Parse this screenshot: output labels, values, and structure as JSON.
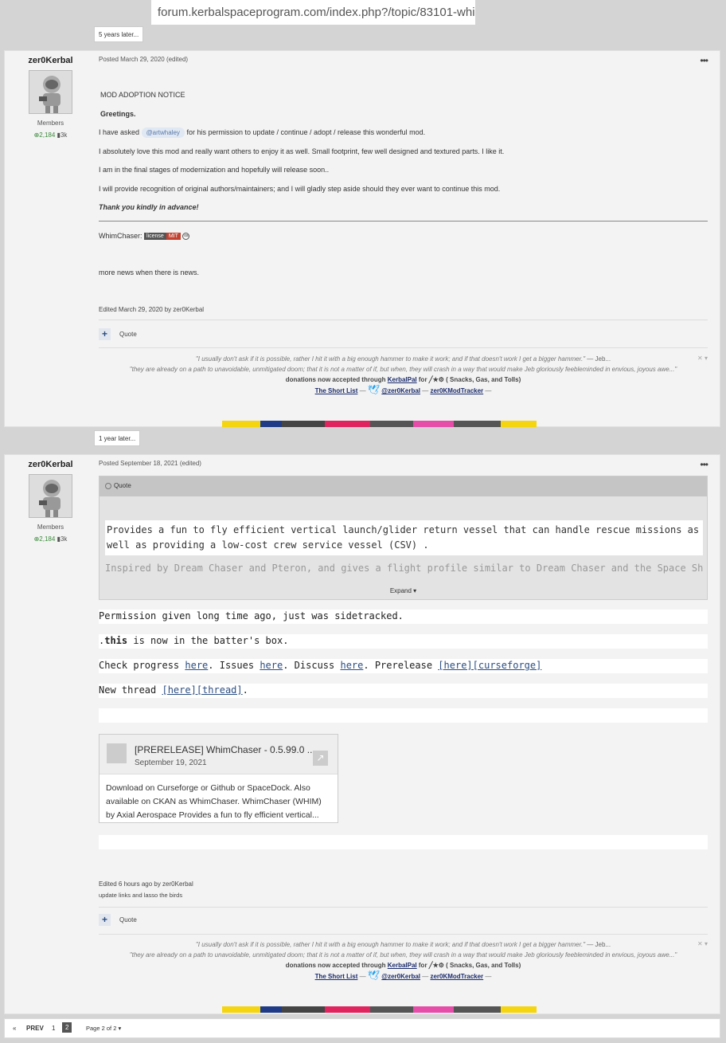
{
  "browser": {
    "url": "forum.kerbalspaceprogram.com/index.php?/topic/83101-whi..."
  },
  "gaps": [
    "5 years later...",
    "1 year later..."
  ],
  "post1": {
    "author": "zer0Kerbal",
    "group": "Members",
    "rep": "2,184",
    "posts": "3k",
    "meta": "Posted March 29, 2020 (edited)",
    "lines": {
      "notice": "MOD ADOPTION NOTICE",
      "greet": "Greetings.",
      "asked_pre": "I have asked",
      "mention": "@artwhaley",
      "asked_post": "for his permission to update / continue / adopt / release this wonderful mod.",
      "love": "I absolutely love this mod and really want others to enjoy it as well. Small footprint, few well designed and textured parts. I like it.",
      "final": "I am in the final stages of modernization and hopefully will release soon..",
      "recognition": "I will provide recognition of original authors/maintainers; and I will gladly step aside should they ever want to continue this mod.",
      "thanks": "Thank you kindly in advance!",
      "whim": "WhimChaser:",
      "lic_l": "license",
      "lic_r": "MIT",
      "news": "more news when there is news."
    },
    "edited": "Edited March 29, 2020 by zer0Kerbal",
    "quote": "Quote"
  },
  "post2": {
    "author": "zer0Kerbal",
    "group": "Members",
    "rep": "2,184",
    "posts": "3k",
    "meta": "Posted September 18, 2021 (edited)",
    "quote_label": "Quote",
    "quote_text": "Provides a fun to fly efficient vertical launch/glider return vessel that can handle rescue missions as well as providing a low-cost crew service vessel (CSV) .",
    "quote_text2": "Inspired by Dream Chaser and Pteron, and gives a flight profile similar to Dream Chaser and the Space Shuttle, so it's",
    "expand": "Expand ▾",
    "l1": "Permission given long time ago, just was sidetracked.",
    "l2a": ".",
    "l2b": "this",
    "l2c": " is now in the batter's box.",
    "l3": {
      "a": "Check progress ",
      "b": "here",
      "c": ". Issues ",
      "d": "here",
      "e": ". Discuss ",
      "f": "here",
      "g": ". Prerelease ",
      "h": "[here][curseforge]"
    },
    "l4": {
      "a": "New thread ",
      "b": "[here][thread]",
      "c": "."
    },
    "card": {
      "title": "[PRERELEASE] WhimChaser - 0.5.99.0 ...",
      "date": "September 19, 2021",
      "body": "Download on Curseforge or Github or SpaceDock. Also available on CKAN as WhimChaser. WhimChaser (WHIM) by Axial Aerospace Provides a fun to fly efficient vertical..."
    },
    "edited": "Edited 6 hours ago by zer0Kerbal",
    "reason": "update links and lasso the birds",
    "quote": "Quote"
  },
  "signature": {
    "line1": "\"I usually don't ask if it is possible, rather I hit it with a big enough hammer to make it work; and if that doesn't work I get a bigger hammer.\"",
    "line1b": " — Jeb...",
    "line2": "\"they are already on a path to unavoidable, unmitigated doom; that it is not a matter of if, but when, they will crash in a way that would make Jeb gloriously feebleminded in envious, joyous awe...\"",
    "don_pre": "donations now accepted through",
    "don_link": "KerbalPal",
    "don_post": "for  ╱★⚙ ( Snacks, Gas, and Tolls)",
    "short": "The Short List",
    "twitter": "@zer0Kerbal",
    "tracker": "zer0KModTracker",
    "dash": " — ",
    "close": "✕ ▾"
  },
  "pager": {
    "prev_arrow": "«",
    "prev": "PREV",
    "p1": "1",
    "p2": "2",
    "pageof": "Page 2 of 2 ▾"
  },
  "colors": {
    "badge": [
      "#f4d50f",
      "#1f3b87",
      "#444",
      "#e0245e",
      "#555",
      "#e54da8",
      "#555",
      "#f4d50f"
    ]
  }
}
